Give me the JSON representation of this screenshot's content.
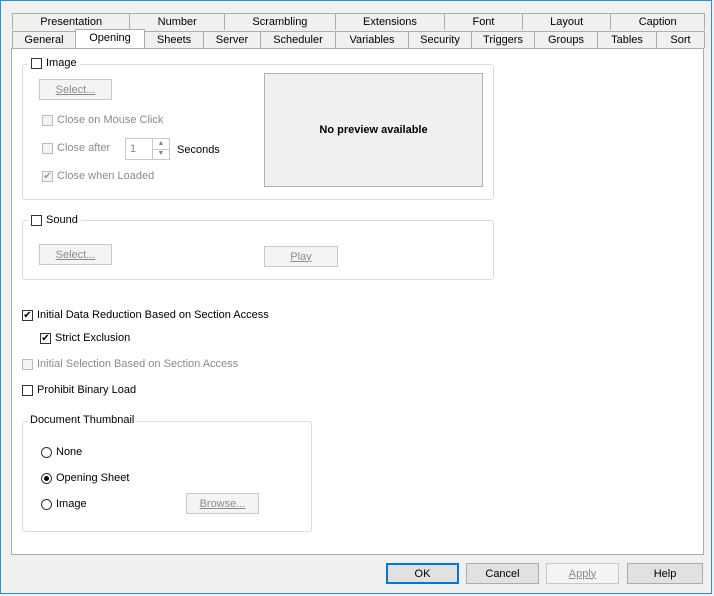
{
  "tabs": {
    "row1": [
      "Presentation",
      "Number",
      "Scrambling",
      "Extensions",
      "Font",
      "Layout",
      "Caption"
    ],
    "row2": [
      "General",
      "Opening",
      "Sheets",
      "Server",
      "Scheduler",
      "Variables",
      "Security",
      "Triggers",
      "Groups",
      "Tables",
      "Sort"
    ],
    "selected": "Opening"
  },
  "image_group": {
    "label": "Image",
    "select_label": "Select...",
    "close_on_click": "Close on Mouse Click",
    "close_after": "Close after",
    "close_after_value": "1",
    "seconds": "Seconds",
    "close_when_loaded": "Close when Loaded",
    "preview_text": "No preview available"
  },
  "sound_group": {
    "label": "Sound",
    "select_label": "Select...",
    "play_label": "Play"
  },
  "options": {
    "initial_reduction": "Initial Data Reduction Based on Section Access",
    "strict_exclusion": "Strict Exclusion",
    "initial_selection": "Initial Selection Based on Section Access",
    "prohibit_binary": "Prohibit Binary Load"
  },
  "thumbnail": {
    "title": "Document Thumbnail",
    "none": "None",
    "opening_sheet": "Opening Sheet",
    "image": "Image",
    "browse": "Browse..."
  },
  "footer": {
    "ok": "OK",
    "cancel": "Cancel",
    "apply": "Apply",
    "help": "Help"
  },
  "colors": {
    "highlight": "#f5f500",
    "accent": "#0078d7"
  }
}
